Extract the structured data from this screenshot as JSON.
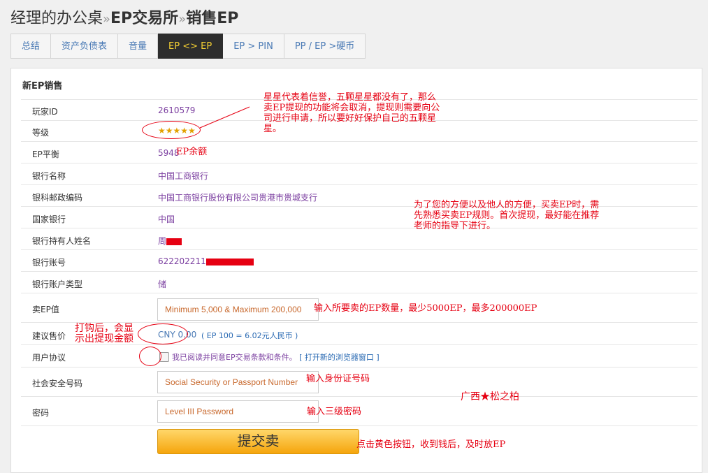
{
  "breadcrumb": {
    "part1": "经理的办公桌",
    "sep1": "»",
    "part2": "EP交易所",
    "sep2": "»",
    "part3": "销售EP"
  },
  "tabs": [
    {
      "label": "总结"
    },
    {
      "label": "资产负债表"
    },
    {
      "label": "音量"
    },
    {
      "label": "EP <> EP"
    },
    {
      "label": "EP > PIN"
    },
    {
      "label": "PP / EP >硬币"
    }
  ],
  "form": {
    "title": "新EP销售",
    "player_id_label": "玩家ID",
    "player_id": "2610579",
    "level_label": "等级",
    "stars": "★★★★★",
    "balance_label": "EP平衡",
    "balance": "5948",
    "bank_name_label": "银行名称",
    "bank_name": "中国工商银行",
    "branch_label": "银科邮政编码",
    "branch": "中国工商银行股份有限公司贵港市贵城支行",
    "country_bank_label": "国家银行",
    "country_bank": "中国",
    "holder_label": "银行持有人姓名",
    "holder": "周",
    "account_label": "银行账号",
    "account": "622202211",
    "account_type_label": "银行账户类型",
    "account_type": "储",
    "sell_label": "卖EP值",
    "sell_placeholder": "Minimum 5,000 & Maximum 200,000",
    "price_label": "建议售价",
    "price_value": "CNY 0.00",
    "price_rate": "( EP 100 = 6.02元人民币 )",
    "agreement_label": "用户协议",
    "agreement_text": "我已阅读并同意EP交易条款和条件。",
    "agreement_link": "[ 打开新的浏览器窗口 ]",
    "ssn_label": "社会安全号码",
    "ssn_placeholder": "Social Security or Passport Number",
    "password_label": "密码",
    "password_placeholder": "Level III Password",
    "submit_label": "提交卖"
  },
  "annotations": {
    "stars_note": "星星代表着信誉，五颗星星都没有了，那么卖EP提现的功能将会取消，提现则需要向公司进行申请，所以要好好保护自己的五颗星星。",
    "balance_note": "EP余额",
    "convenience_note": "为了您的方便以及他人的方便，买卖EP时，需先熟悉买卖EP规则。首次提现，最好能在推荐老师的指导下进行。",
    "sell_note": "输入所要卖的EP数量，最少5000EP，最多200000EP",
    "checkbox_note": "打钩后，会显示出提现金额",
    "ssn_note": "输入身份证号码",
    "watermark": "广西★松之柏",
    "password_note": "输入三级密码",
    "submit_note": "点击黄色按钮，收到钱后，及时放EP"
  },
  "colors": {
    "tab_active_bg": "#2d2d2d",
    "tab_active_text": "#f5d033",
    "value_text": "#7b3fa0",
    "annotation_red": "#e60012",
    "button_yellow": "#f5a50c"
  }
}
